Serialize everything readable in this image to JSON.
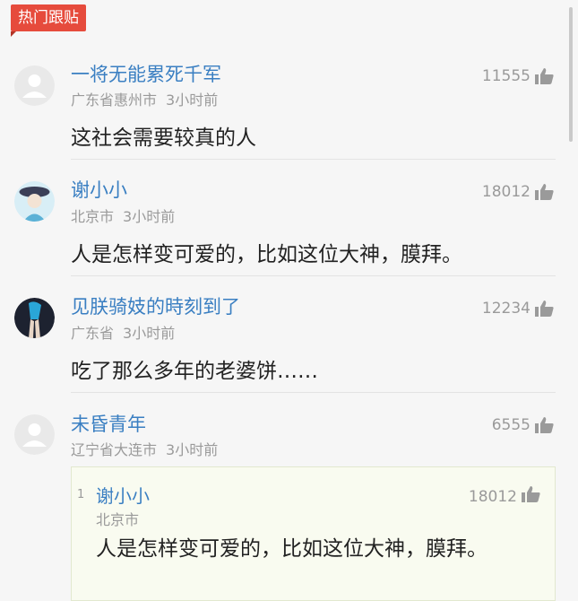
{
  "section_label": "热门跟贴",
  "comments": [
    {
      "user": "一将无能累死千军",
      "location": "广东省惠州市",
      "time": "3小时前",
      "likes": "11555",
      "content": "这社会需要较真的人"
    },
    {
      "user": "谢小小",
      "location": "北京市",
      "time": "3小时前",
      "likes": "18012",
      "content": "人是怎样变可爱的，比如这位大神，膜拜。"
    },
    {
      "user": "见朕骑妓的時刻到了",
      "location": "广东省",
      "time": "3小时前",
      "likes": "12234",
      "content": "吃了那么多年的老婆饼……"
    },
    {
      "user": "未昏青年",
      "location": "辽宁省大连市",
      "time": "3小时前",
      "likes": "6555",
      "quote": {
        "floor": "1",
        "user": "谢小小",
        "location": "北京市",
        "likes": "18012",
        "content": "人是怎样变可爱的，比如这位大神，膜拜。"
      }
    }
  ],
  "colors": {
    "accent": "#e64b3c",
    "username": "#3a7fc2",
    "meta": "#9a9a9a",
    "quote_bg": "#f9fbf0"
  },
  "icons": {
    "like": "thumbs-up-icon",
    "default_avatar": "user-avatar-icon"
  }
}
